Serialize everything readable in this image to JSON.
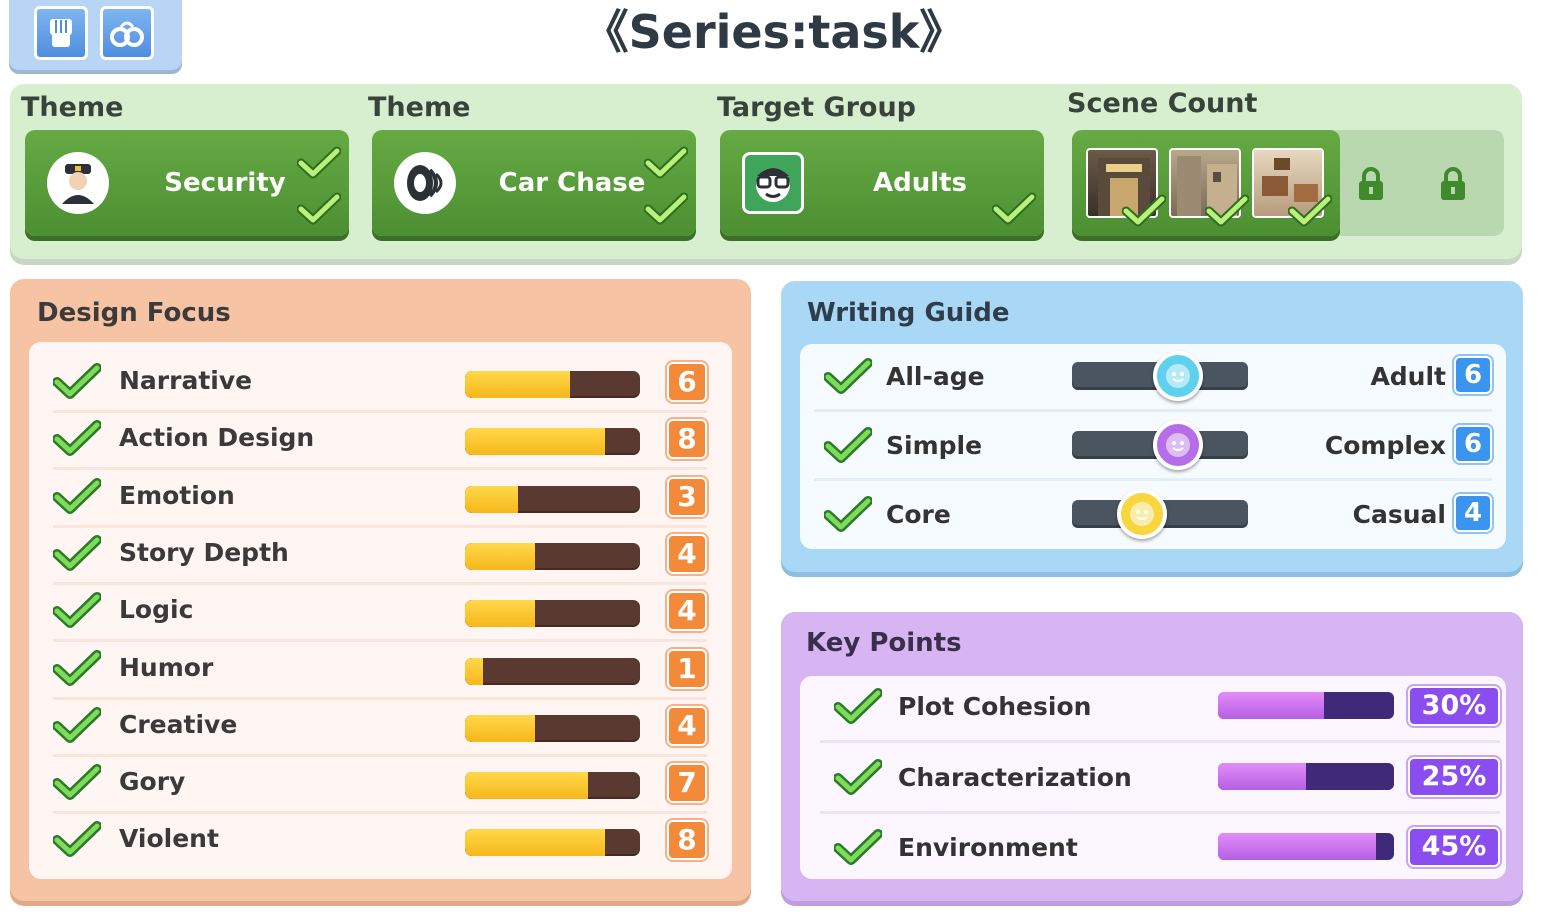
{
  "title": "《Series:task》",
  "top_icons": [
    {
      "icon": "fist-icon"
    },
    {
      "icon": "handcuffs-icon"
    }
  ],
  "settings": {
    "theme1": {
      "header": "Theme",
      "label": "Security",
      "icon": "police-officer-icon"
    },
    "theme2": {
      "header": "Theme",
      "label": "Car Chase",
      "icon": "tire-icon"
    },
    "target": {
      "header": "Target Group",
      "label": "Adults",
      "icon": "adult-face-icon"
    },
    "scenes": {
      "header": "Scene Count",
      "unlocked": 3,
      "locked": 2
    }
  },
  "design_focus": {
    "title": "Design Focus",
    "max": 10,
    "items": [
      {
        "label": "Narrative",
        "value": 6
      },
      {
        "label": "Action Design",
        "value": 8
      },
      {
        "label": "Emotion",
        "value": 3
      },
      {
        "label": "Story Depth",
        "value": 4
      },
      {
        "label": "Logic",
        "value": 4
      },
      {
        "label": "Humor",
        "value": 1
      },
      {
        "label": "Creative",
        "value": 4
      },
      {
        "label": "Gory",
        "value": 7
      },
      {
        "label": "Violent",
        "value": 8
      }
    ]
  },
  "writing_guide": {
    "title": "Writing Guide",
    "max": 10,
    "items": [
      {
        "left": "All-age",
        "right": "Adult",
        "value": 6,
        "knob_color": "#5fd0ee"
      },
      {
        "left": "Simple",
        "right": "Complex",
        "value": 6,
        "knob_color": "#b56ee8"
      },
      {
        "left": "Core",
        "right": "Casual",
        "value": 4,
        "knob_color": "#f7d640"
      }
    ]
  },
  "key_points": {
    "title": "Key Points",
    "items": [
      {
        "label": "Plot Cohesion",
        "value": "30%",
        "fill": 0.6
      },
      {
        "label": "Characterization",
        "value": "25%",
        "fill": 0.5
      },
      {
        "label": "Environment",
        "value": "45%",
        "fill": 0.9
      }
    ]
  },
  "colors": {
    "settings_bg": "#d7efcf",
    "card_green": "#5a9e3c",
    "design_bg": "#f6c3a4",
    "design_badge": "#f38a3a",
    "guide_bg": "#a9d8f6",
    "guide_badge": "#3b94ee",
    "key_bg": "#d7b5f3",
    "key_badge": "#8a4df0"
  }
}
